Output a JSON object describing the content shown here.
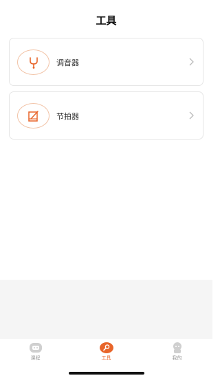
{
  "header": {
    "title": "工具"
  },
  "tools": [
    {
      "label": "调音器",
      "icon": "tuning-fork-icon"
    },
    {
      "label": "节拍器",
      "icon": "metronome-icon"
    }
  ],
  "tabbar": {
    "tabs": [
      {
        "label": "课程",
        "icon": "course-icon",
        "active": false
      },
      {
        "label": "工具",
        "icon": "tools-icon",
        "active": true
      },
      {
        "label": "我的",
        "icon": "profile-icon",
        "active": false
      }
    ]
  },
  "colors": {
    "accent": "#e8652a",
    "inactive": "#999999",
    "card_border": "#e6e6e6",
    "gray_band": "#f5f5f5"
  }
}
